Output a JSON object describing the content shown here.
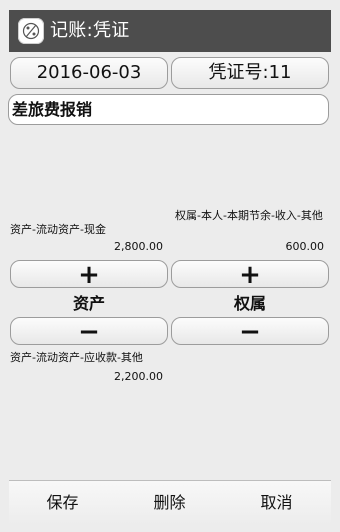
{
  "colors": {
    "titlebar_bg": "#4d4d4d",
    "screen_bg": "#ececec",
    "button_border": "#9c9c9c",
    "text": "#111111"
  },
  "titlebar": {
    "title": "记账:凭证",
    "icon": "ledger-app-icon"
  },
  "header": {
    "date": "2016-06-03",
    "voucher_number": "凭证号:11"
  },
  "memo": {
    "value": "差旅费报销"
  },
  "debit": {
    "entry": {
      "account": "资产-流动资产-现金",
      "amount": "2,800.00"
    },
    "plus_icon": "plus-icon",
    "label": "资产",
    "minus_icon": "minus-icon",
    "entry2": {
      "account": "资产-流动资产-应收款-其他",
      "amount": "2,200.00"
    }
  },
  "credit": {
    "entry": {
      "account": "权属-本人-本期节余-收入-其他",
      "amount": "600.00"
    },
    "plus_icon": "plus-icon",
    "label": "权属",
    "minus_icon": "minus-icon"
  },
  "actions": {
    "save": "保存",
    "delete": "删除",
    "cancel": "取消"
  }
}
